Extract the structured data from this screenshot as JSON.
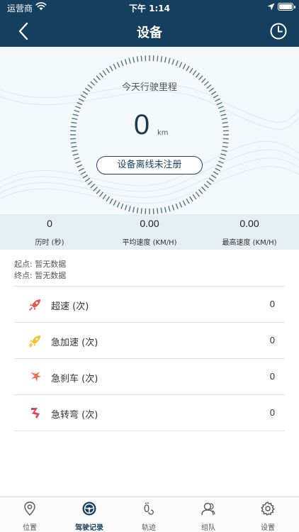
{
  "status_bar": {
    "carrier": "运营商",
    "time": "下午 1:14"
  },
  "nav": {
    "title": "设备",
    "back_icon": "chevron-left-icon",
    "history_icon": "clock-icon"
  },
  "dashboard": {
    "today_label": "今天行驶里程",
    "mileage_value": "0",
    "mileage_unit": "km",
    "device_status": "设备离线未注册"
  },
  "stats": [
    {
      "value": "0",
      "label": "历时 (秒)"
    },
    {
      "value": "0.00",
      "label": "平均速度 (KM/H)"
    },
    {
      "value": "0.00",
      "label": "最高速度 (KM/H)"
    }
  ],
  "route": {
    "start": "起点: 暂无数据",
    "end": "终点: 暂无数据"
  },
  "events": [
    {
      "label": "超速 (次)",
      "count": "0",
      "icon": "rocket-icon",
      "color": "#e05a4f"
    },
    {
      "label": "急加速 (次)",
      "count": "0",
      "icon": "lightning-rocket-icon",
      "color": "#f2c12e"
    },
    {
      "label": "急刹车 (次)",
      "count": "0",
      "icon": "brake-icon",
      "color": "#e8734f"
    },
    {
      "label": "急转弯 (次)",
      "count": "0",
      "icon": "sharp-turn-icon",
      "color": "#d94652"
    }
  ],
  "tabbar": {
    "active_index": 1,
    "items": [
      {
        "label": "位置",
        "icon": "location-pin-icon"
      },
      {
        "label": "驾驶记录",
        "icon": "steering-wheel-icon"
      },
      {
        "label": "轨迹",
        "icon": "footprint-icon"
      },
      {
        "label": "组队",
        "icon": "team-icon"
      },
      {
        "label": "设置",
        "icon": "gear-icon"
      }
    ]
  },
  "colors": {
    "header": "#153f5e",
    "accent": "#1d4561",
    "dash_bg": "#f3f9fb",
    "stats_bg": "#e5eef1"
  }
}
